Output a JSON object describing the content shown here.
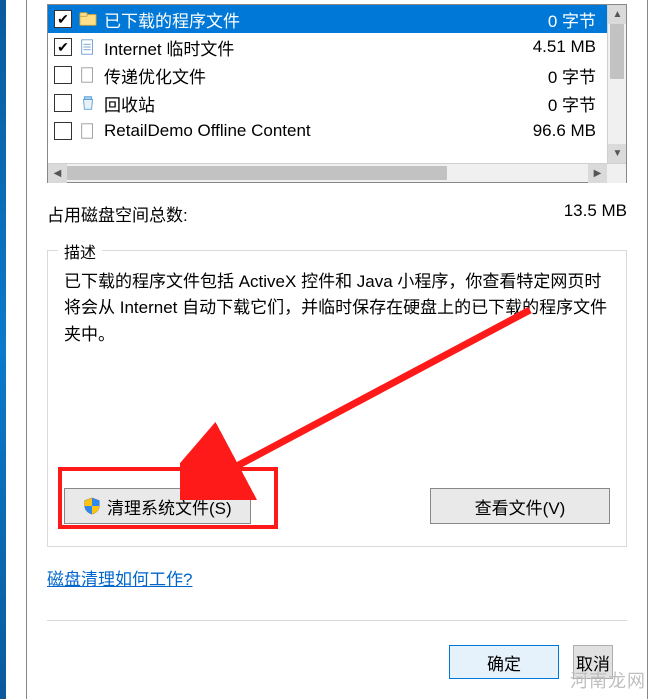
{
  "list": {
    "items": [
      {
        "label": "已下载的程序文件",
        "size": "0 字节",
        "checked": true,
        "selected": true,
        "icon": "folder-icon"
      },
      {
        "label": "Internet 临时文件",
        "size": "4.51 MB",
        "checked": true,
        "selected": false,
        "icon": "page-icon"
      },
      {
        "label": "传递优化文件",
        "size": "0 字节",
        "checked": false,
        "selected": false,
        "icon": "page-icon"
      },
      {
        "label": "回收站",
        "size": "0 字节",
        "checked": false,
        "selected": false,
        "icon": "recycle-icon"
      },
      {
        "label": "RetailDemo Offline Content",
        "size": "96.6 MB",
        "checked": false,
        "selected": false,
        "icon": "page-icon"
      }
    ]
  },
  "total": {
    "label": "占用磁盘空间总数:",
    "value": "13.5 MB"
  },
  "description": {
    "legend": "描述",
    "text": "已下载的程序文件包括 ActiveX 控件和 Java 小程序，你查看特定网页时将会从 Internet 自动下载它们，并临时保存在硬盘上的已下载的程序文件夹中。"
  },
  "buttons": {
    "clean_system": "清理系统文件(S)",
    "view_files": "查看文件(V)"
  },
  "help_link": "磁盘清理如何工作?",
  "dialog": {
    "ok": "确定",
    "cancel": "取消"
  },
  "watermark": "河南龙网",
  "colors": {
    "highlight": "#ff1a1a",
    "selection": "#0078d7"
  }
}
